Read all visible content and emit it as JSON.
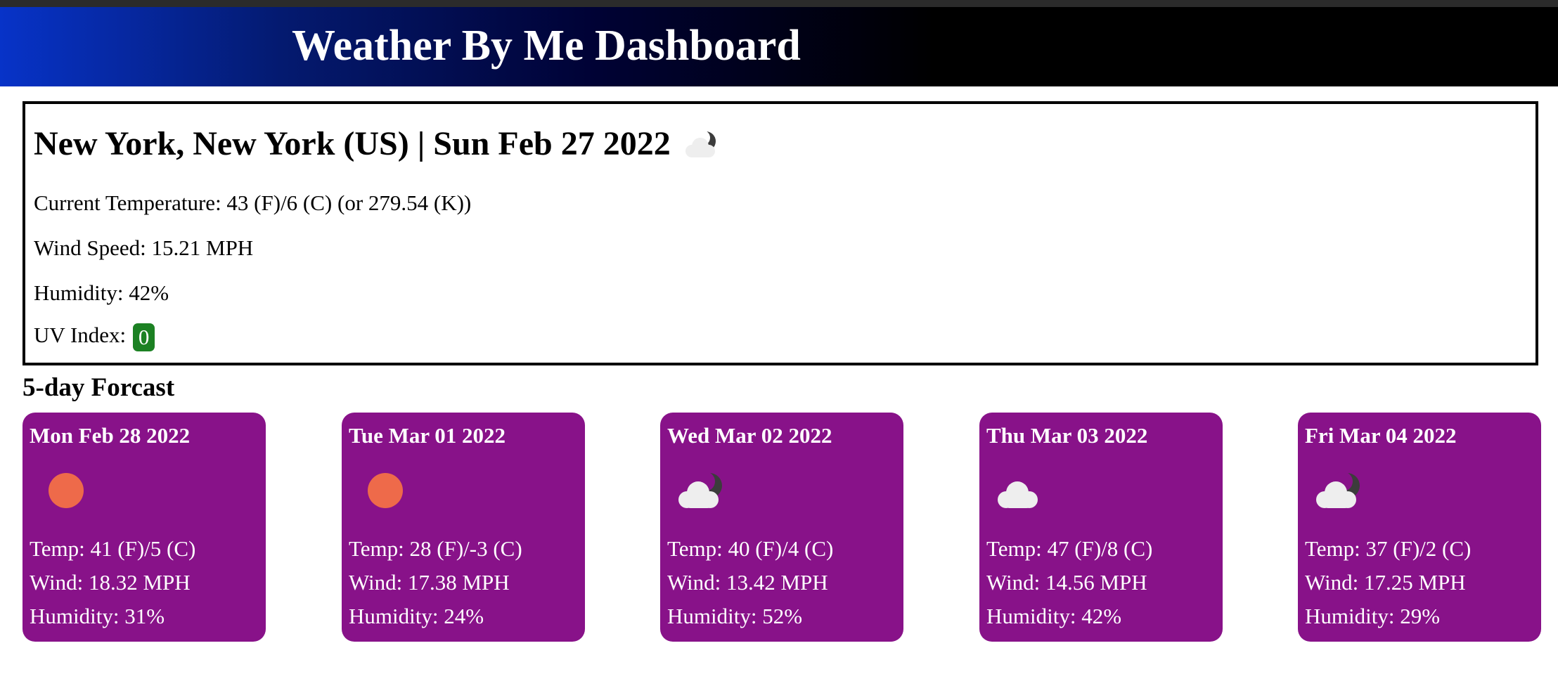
{
  "header": {
    "title": "Weather By Me Dashboard"
  },
  "current": {
    "title": "New York, New York (US) | Sun Feb 27 2022",
    "icon": "partly-cloudy-night-icon",
    "temperature_label": "Current Temperature: 43 (F)/6 (C) (or 279.54 (K))",
    "wind_label": "Wind Speed: 15.21 MPH",
    "humidity_label": "Humidity: 42%",
    "uv_label": "UV Index:",
    "uv_value": "0",
    "uv_color": "#1c8123"
  },
  "forecast": {
    "heading": "5-day Forcast",
    "card_color": "#881289",
    "days": [
      {
        "date": "Mon Feb 28 2022",
        "icon": "sun-icon",
        "temp": "Temp: 41 (F)/5 (C)",
        "wind": "Wind: 18.32 MPH",
        "humidity": "Humidity: 31%"
      },
      {
        "date": "Tue Mar 01 2022",
        "icon": "sun-icon",
        "temp": "Temp: 28 (F)/-3 (C)",
        "wind": "Wind: 17.38 MPH",
        "humidity": "Humidity: 24%"
      },
      {
        "date": "Wed Mar 02 2022",
        "icon": "partly-cloudy-night-icon",
        "temp": "Temp: 40 (F)/4 (C)",
        "wind": "Wind: 13.42 MPH",
        "humidity": "Humidity: 52%"
      },
      {
        "date": "Thu Mar 03 2022",
        "icon": "cloud-icon",
        "temp": "Temp: 47 (F)/8 (C)",
        "wind": "Wind: 14.56 MPH",
        "humidity": "Humidity: 42%"
      },
      {
        "date": "Fri Mar 04 2022",
        "icon": "partly-cloudy-night-icon",
        "temp": "Temp: 37 (F)/2 (C)",
        "wind": "Wind: 17.25 MPH",
        "humidity": "Humidity: 29%"
      }
    ]
  }
}
